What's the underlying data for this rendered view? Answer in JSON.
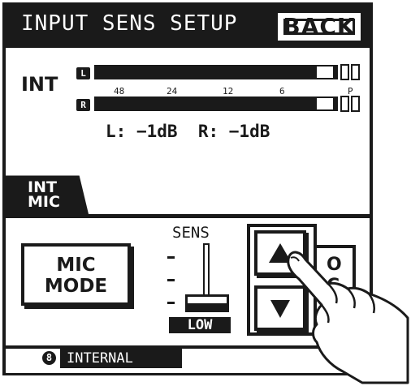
{
  "header": {
    "title": "INPUT SENS SETUP",
    "back_label": "BACK"
  },
  "meter": {
    "source_label": "INT",
    "left_tag": "L",
    "right_tag": "R",
    "scale": [
      "48",
      "24",
      "12",
      "6",
      "P"
    ],
    "left_readout_label": "L:",
    "left_readout_value": "−1dB",
    "right_readout_label": "R:",
    "right_readout_value": "−1dB",
    "left_level_fraction": 0.96,
    "right_level_fraction": 0.96
  },
  "tab": {
    "line1": "INT",
    "line2": "MIC"
  },
  "mic_mode": {
    "line1": "MIC",
    "line2": "MODE"
  },
  "sens": {
    "label": "SENS",
    "value_label": "LOW",
    "level_fraction": 0.0
  },
  "arrows": {
    "up_icon": "up-triangle-icon",
    "down_icon": "down-triangle-icon"
  },
  "side_button": {
    "line1": "O",
    "line2": "C"
  },
  "status": {
    "number": "8",
    "text": "INTERNAL"
  },
  "colors": {
    "ink": "#1a1a1a",
    "paper": "#ffffff"
  }
}
